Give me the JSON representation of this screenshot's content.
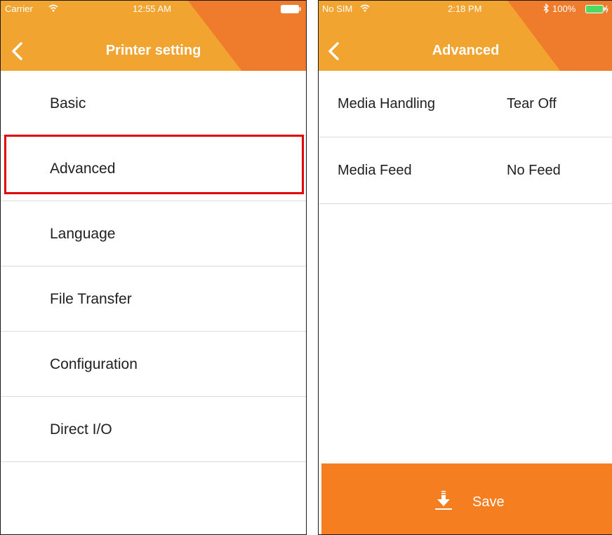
{
  "left_screen": {
    "status": {
      "carrier": "Carrier",
      "time": "12:55 AM"
    },
    "nav": {
      "title": "Printer setting",
      "back_icon": "chevron-left-icon"
    },
    "menu_items": [
      {
        "label": "Basic"
      },
      {
        "label": "Advanced",
        "highlighted": true
      },
      {
        "label": "Language"
      },
      {
        "label": "File Transfer"
      },
      {
        "label": "Configuration"
      },
      {
        "label": "Direct I/O"
      }
    ]
  },
  "right_screen": {
    "status": {
      "carrier": "No SIM",
      "time": "2:18 PM",
      "battery": "100%"
    },
    "nav": {
      "title": "Advanced",
      "back_icon": "chevron-left-icon"
    },
    "settings": [
      {
        "label": "Media Handling",
        "value": "Tear Off"
      },
      {
        "label": "Media Feed",
        "value": "No Feed"
      }
    ],
    "save": {
      "label": "Save",
      "icon": "download-icon"
    }
  },
  "colors": {
    "header_orange": "#f2a431",
    "header_accent": "#ef7b2c",
    "save_orange": "#f57e20",
    "highlight_red": "#e00000"
  }
}
